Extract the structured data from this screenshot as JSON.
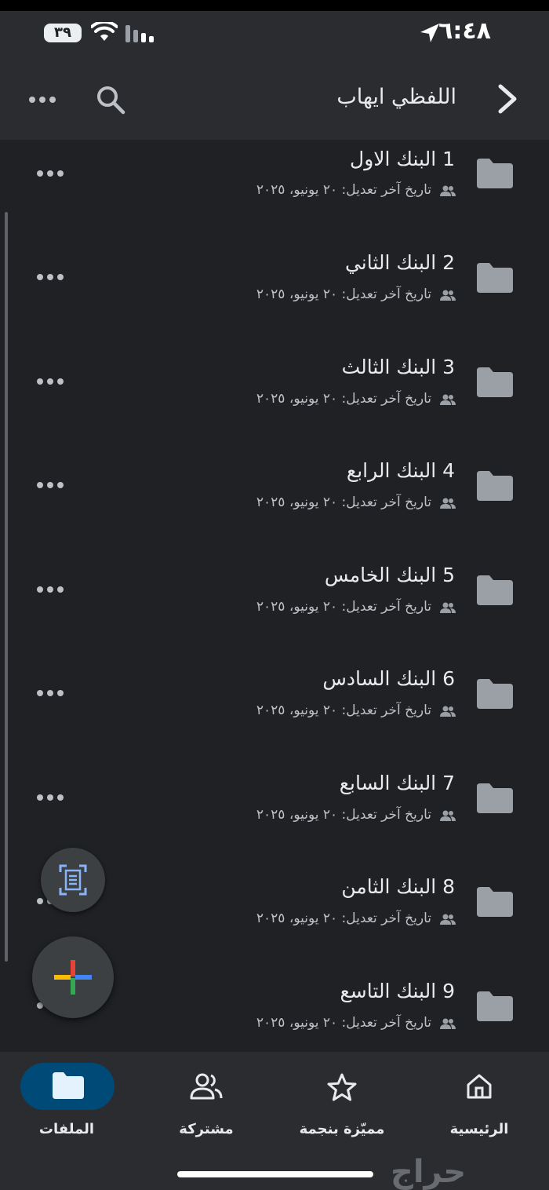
{
  "status_bar": {
    "time": "٦:٤٨",
    "battery": "٣٩"
  },
  "header": {
    "title": "اللفظي ايهاب"
  },
  "items": [
    {
      "name": "1 البنك الاول",
      "meta": "تاريخ آخر تعديل: ٢٠ يونيو، ٢٠٢٥"
    },
    {
      "name": "2 البنك الثاني",
      "meta": "تاريخ آخر تعديل: ٢٠ يونيو، ٢٠٢٥"
    },
    {
      "name": "3 البنك الثالث",
      "meta": "تاريخ آخر تعديل: ٢٠ يونيو، ٢٠٢٥"
    },
    {
      "name": "4 البنك الرابع",
      "meta": "تاريخ آخر تعديل: ٢٠ يونيو، ٢٠٢٥"
    },
    {
      "name": "5 البنك الخامس",
      "meta": "تاريخ آخر تعديل: ٢٠ يونيو، ٢٠٢٥"
    },
    {
      "name": "6 البنك السادس",
      "meta": "تاريخ آخر تعديل: ٢٠ يونيو، ٢٠٢٥"
    },
    {
      "name": "7 البنك السابع",
      "meta": "تاريخ آخر تعديل: ٢٠ يونيو، ٢٠٢٥"
    },
    {
      "name": "8 البنك الثامن",
      "meta": "تاريخ آخر تعديل: ٢٠ يونيو، ٢٠٢٥"
    },
    {
      "name": "9 البنك التاسع",
      "meta": "تاريخ آخر تعديل: ٢٠ يونيو، ٢٠٢٥"
    }
  ],
  "bottom_nav": {
    "home": "الرئيسية",
    "starred": "مميّزة بنجمة",
    "shared": "مشتركة",
    "files": "الملفات"
  },
  "watermark": "حراج",
  "icons": {
    "back": "chevron-right-icon",
    "search": "search-icon",
    "more": "more-horiz-icon",
    "folder": "folder-icon",
    "shared": "people-icon",
    "scan": "document-scan-icon",
    "new": "plus-icon"
  },
  "colors": {
    "background": "#202124",
    "bar": "#2b2c2f",
    "active_nav": "#004a77",
    "folder": "#9aa0a6"
  }
}
